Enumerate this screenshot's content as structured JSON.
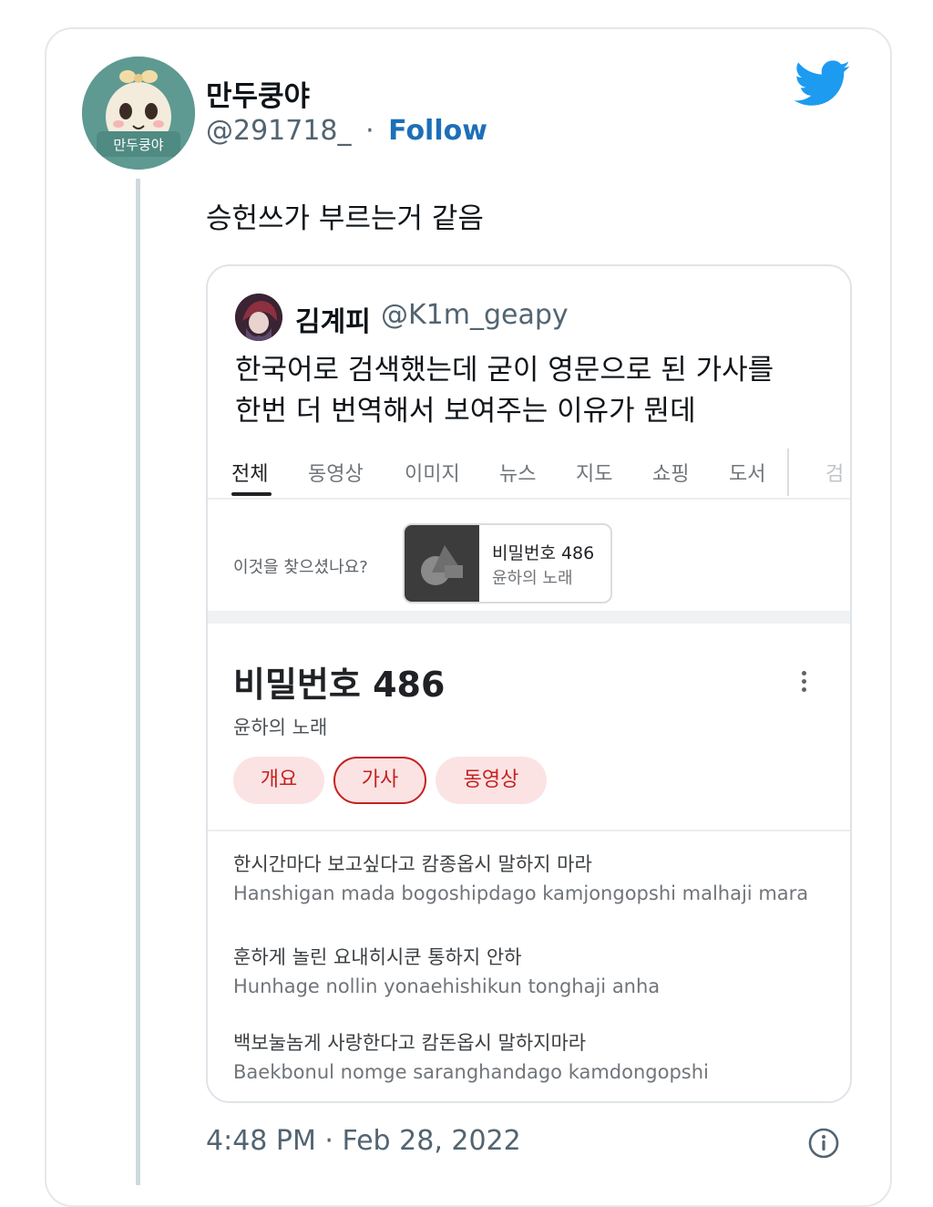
{
  "tweet": {
    "author": {
      "name": "만두쿵야",
      "handle": "@291718_",
      "separator": "·",
      "follow_label": "Follow",
      "avatar_badge": "만두쿵야"
    },
    "text": "승헌쓰가 부르는거 같음",
    "timestamp": "4:48 PM · Feb 28, 2022"
  },
  "quote": {
    "author": {
      "name": "김계피",
      "handle": "@K1m_geapy"
    },
    "text_line1": "한국어로 검색했는데 굳이 영문으로 된 가사를",
    "text_line2": "한번 더 번역해서 보여주는 이유가 뭔데"
  },
  "search": {
    "tabs": [
      "전체",
      "동영상",
      "이미지",
      "뉴스",
      "지도",
      "쇼핑",
      "도서",
      "검"
    ],
    "did_you_mean": "이것을 찾으셨나요?",
    "suggestion": {
      "title": "비밀번호 486",
      "subtitle": "윤하의 노래"
    },
    "song_title": "비밀번호 486",
    "song_subtitle": "윤하의 노래",
    "chips": [
      "개요",
      "가사",
      "동영상"
    ],
    "lyrics": [
      {
        "ko": "한시간마다 보고싶다고 캄종옵시 말하지 마라",
        "en": "Hanshigan mada bogoshipdago kamjongopshi malhaji mara"
      },
      {
        "ko": "훈하게 놀린 요내히시쿤 통하지 안하",
        "en": "Hunhage nollin yonaehishikun tonghaji anha"
      },
      {
        "ko": "백보눌놈게 사랑한다고 캄돈옵시 말하지마라",
        "en": "Baekbonul nomge saranghandago kamdongopshi"
      }
    ]
  },
  "colors": {
    "follow": "#1d6fb8",
    "twitter_blue": "#1d9bf0",
    "chip_text": "#c5221f",
    "chip_bg": "#fbe3e4"
  },
  "icons": {
    "logo": "twitter-bird-icon",
    "info": "info-icon",
    "more": "more-vert-icon"
  }
}
